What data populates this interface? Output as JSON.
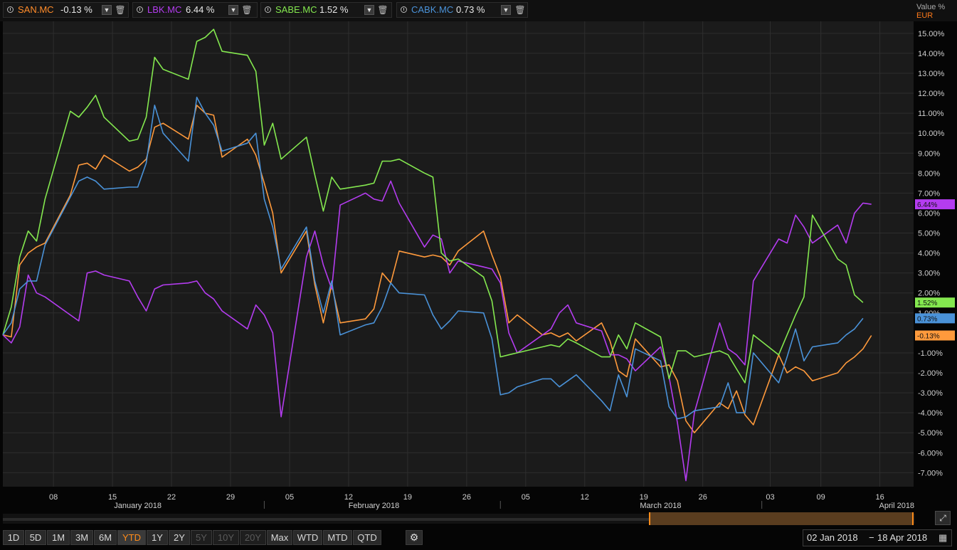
{
  "header": {
    "tabs": [
      {
        "symbol": "SAN.MC",
        "value": "-0.13 %",
        "color": "#ff8c2a"
      },
      {
        "symbol": "LBK.MC",
        "value": "6.44 %",
        "color": "#b43cf0"
      },
      {
        "symbol": "SABE.MC",
        "value": "1.52 %",
        "color": "#84e84f"
      },
      {
        "symbol": "CABK.MC",
        "value": "0.73 %",
        "color": "#4a92d8"
      }
    ],
    "value_label": "Value %",
    "currency": "EUR"
  },
  "chart_data": {
    "type": "line",
    "ylim": [
      -7.7,
      15.6
    ],
    "y_ticks": [
      "15.00%",
      "14.00%",
      "13.00%",
      "12.00%",
      "11.00%",
      "10.00%",
      "9.00%",
      "8.00%",
      "7.00%",
      "6.00%",
      "5.00%",
      "4.00%",
      "3.00%",
      "2.00%",
      "1.00%",
      "-1.00%",
      "-2.00%",
      "-3.00%",
      "-4.00%",
      "-5.00%",
      "-6.00%",
      "-7.00%"
    ],
    "y_tick_values": [
      15,
      14,
      13,
      12,
      11,
      10,
      9,
      8,
      7,
      6,
      5,
      4,
      3,
      2,
      1,
      -1,
      -2,
      -3,
      -4,
      -5,
      -6,
      -7
    ],
    "x_ticks": [
      "08",
      "15",
      "22",
      "29",
      "05",
      "12",
      "19",
      "26",
      "05",
      "12",
      "19",
      "26",
      "03",
      "09",
      "16"
    ],
    "x_tick_days": [
      6,
      13,
      20,
      27,
      34,
      41,
      48,
      55,
      62,
      69,
      76,
      83,
      91,
      97,
      104
    ],
    "months": [
      {
        "label": "January 2018",
        "day": 16
      },
      {
        "label": "February 2018",
        "day": 44
      },
      {
        "label": "March 2018",
        "day": 78
      },
      {
        "label": "April 2018",
        "day": 106
      }
    ],
    "month_separators": [
      31,
      59,
      90
    ],
    "x_range": [
      0,
      108
    ],
    "days": [
      0,
      1,
      2,
      3,
      4,
      5,
      8,
      9,
      10,
      11,
      12,
      15,
      16,
      17,
      18,
      19,
      22,
      23,
      24,
      25,
      26,
      29,
      30,
      31,
      32,
      33,
      36,
      37,
      38,
      39,
      40,
      43,
      44,
      45,
      46,
      47,
      50,
      51,
      52,
      53,
      54,
      57,
      58,
      59,
      60,
      61,
      64,
      65,
      66,
      67,
      68,
      71,
      72,
      73,
      74,
      75,
      78,
      79,
      80,
      81,
      82,
      85,
      86,
      87,
      88,
      89,
      92,
      93,
      94,
      95,
      96,
      99,
      100,
      101,
      102,
      103,
      106,
      107
    ],
    "series": [
      {
        "name": "SAN.MC",
        "color": "#ff9a3c",
        "last_label": "-0.13%",
        "values": [
          -0.1,
          -0.2,
          3.4,
          4,
          4.3,
          4.5,
          6.9,
          8.4,
          8.5,
          8.2,
          8.9,
          8.1,
          8.3,
          8.7,
          10.3,
          10.5,
          9.7,
          11.4,
          11,
          10.9,
          8.8,
          9.7,
          8.9,
          7.5,
          6,
          3,
          5.1,
          2.4,
          0.5,
          2.4,
          0.5,
          0.7,
          1.2,
          3,
          2.5,
          4.1,
          3.8,
          3.9,
          3.8,
          3.4,
          4.1,
          5.1,
          3.9,
          2.8,
          0.5,
          0.9,
          -0.1,
          0,
          -0.2,
          0,
          -0.4,
          0.5,
          -0.4,
          -1.9,
          -2.2,
          -0.3,
          -1.7,
          -1.6,
          -2.4,
          -4.4,
          -5,
          -3.5,
          -3.8,
          -2.9,
          -4.1,
          -4.6,
          -1.1,
          -2,
          -1.7,
          -1.9,
          -2.4,
          -2,
          -1.5,
          -1.2,
          -0.8,
          -0.13
        ]
      },
      {
        "name": "LBK.MC",
        "color": "#b43cf0",
        "last_label": "6.44%",
        "values": [
          -0.1,
          -0.5,
          0.3,
          2.9,
          2,
          1.8,
          0.9,
          0.6,
          3,
          3.1,
          2.9,
          2.6,
          1.8,
          1.1,
          2.2,
          2.4,
          2.5,
          2.6,
          2,
          1.7,
          1.1,
          0.2,
          1.4,
          0.9,
          0,
          -4.2,
          3.8,
          5.1,
          3.4,
          2.2,
          6.4,
          7,
          6.7,
          6.6,
          7.6,
          6.5,
          4.3,
          4.9,
          4.7,
          3,
          3.6,
          3.3,
          3.2,
          2.5,
          0,
          -1,
          -0.1,
          0.2,
          1,
          1.4,
          0.5,
          0.1,
          -1.1,
          -1.1,
          -1.3,
          -1.9,
          -0.7,
          -2.2,
          -4.5,
          -7.4,
          -4,
          0.5,
          -0.8,
          -1.1,
          -1.6,
          2.6,
          4.7,
          4.5,
          5.9,
          5.3,
          4.5,
          5.4,
          4.5,
          6,
          6.5,
          6.44
        ]
      },
      {
        "name": "SABE.MC",
        "color": "#84e84f",
        "last_label": "1.52%",
        "values": [
          -0.1,
          1.3,
          3.8,
          5.1,
          4.6,
          6.7,
          11.1,
          10.8,
          11.3,
          11.9,
          10.8,
          9.6,
          9.7,
          10.8,
          13.8,
          13.2,
          12.7,
          14.6,
          14.8,
          15.2,
          14.1,
          13.9,
          13.1,
          9.4,
          10.5,
          8.7,
          9.8,
          7.9,
          6.1,
          7.8,
          7.2,
          7.4,
          7.5,
          8.6,
          8.6,
          8.7,
          8,
          7.8,
          4,
          3.6,
          3.7,
          2.8,
          1.6,
          -1.2,
          -1.1,
          -1,
          -0.7,
          -0.6,
          -0.7,
          -0.3,
          -0.5,
          -1.2,
          -1.2,
          -0.1,
          -0.8,
          0.5,
          -0.2,
          -2.3,
          -0.9,
          -0.9,
          -1.2,
          -0.9,
          -1.1,
          -1.8,
          -2.5,
          -0.1,
          -1.1,
          -0.1,
          0.9,
          1.8,
          5.9,
          3.7,
          3.4,
          1.9,
          1.52
        ]
      },
      {
        "name": "CABK.MC",
        "color": "#4a92d8",
        "last_label": "0.73%",
        "values": [
          -0.1,
          0.5,
          2.2,
          2.6,
          2.6,
          4.4,
          6.8,
          7.6,
          7.8,
          7.6,
          7.2,
          7.3,
          7.3,
          8.5,
          11.4,
          10,
          8.6,
          11.8,
          11,
          10.4,
          9.1,
          9.5,
          10,
          6.7,
          5.3,
          3.2,
          5.3,
          2.6,
          1,
          2.6,
          -0.1,
          0.4,
          0.5,
          1.3,
          2.5,
          2,
          1.9,
          0.9,
          0.2,
          0.6,
          1.1,
          1,
          -0.3,
          -3.1,
          -3,
          -2.7,
          -2.3,
          -2.3,
          -2.7,
          -2.4,
          -2.1,
          -3.4,
          -3.9,
          -2.1,
          -3.2,
          -0.8,
          -1.4,
          -3.7,
          -4.3,
          -4.2,
          -3.9,
          -3.7,
          -2.5,
          -4,
          -4,
          -1,
          -2.5,
          -1.2,
          0.2,
          -1.4,
          -0.7,
          -0.5,
          -0.1,
          0.2,
          0.73
        ]
      }
    ]
  },
  "navigator": {
    "expand_icon": "expand-icon"
  },
  "range_buttons": [
    {
      "label": "1D",
      "state": "normal"
    },
    {
      "label": "5D",
      "state": "normal"
    },
    {
      "label": "1M",
      "state": "normal"
    },
    {
      "label": "3M",
      "state": "normal"
    },
    {
      "label": "6M",
      "state": "normal"
    },
    {
      "label": "YTD",
      "state": "active"
    },
    {
      "label": "1Y",
      "state": "normal"
    },
    {
      "label": "2Y",
      "state": "normal"
    },
    {
      "label": "5Y",
      "state": "disabled"
    },
    {
      "label": "10Y",
      "state": "disabled"
    },
    {
      "label": "20Y",
      "state": "disabled"
    },
    {
      "label": "Max",
      "state": "normal"
    },
    {
      "label": "WTD",
      "state": "normal"
    },
    {
      "label": "MTD",
      "state": "normal"
    },
    {
      "label": "QTD",
      "state": "normal"
    }
  ],
  "date_range": {
    "start": "02 Jan 2018",
    "separator": "−",
    "end": "18 Apr 2018"
  }
}
